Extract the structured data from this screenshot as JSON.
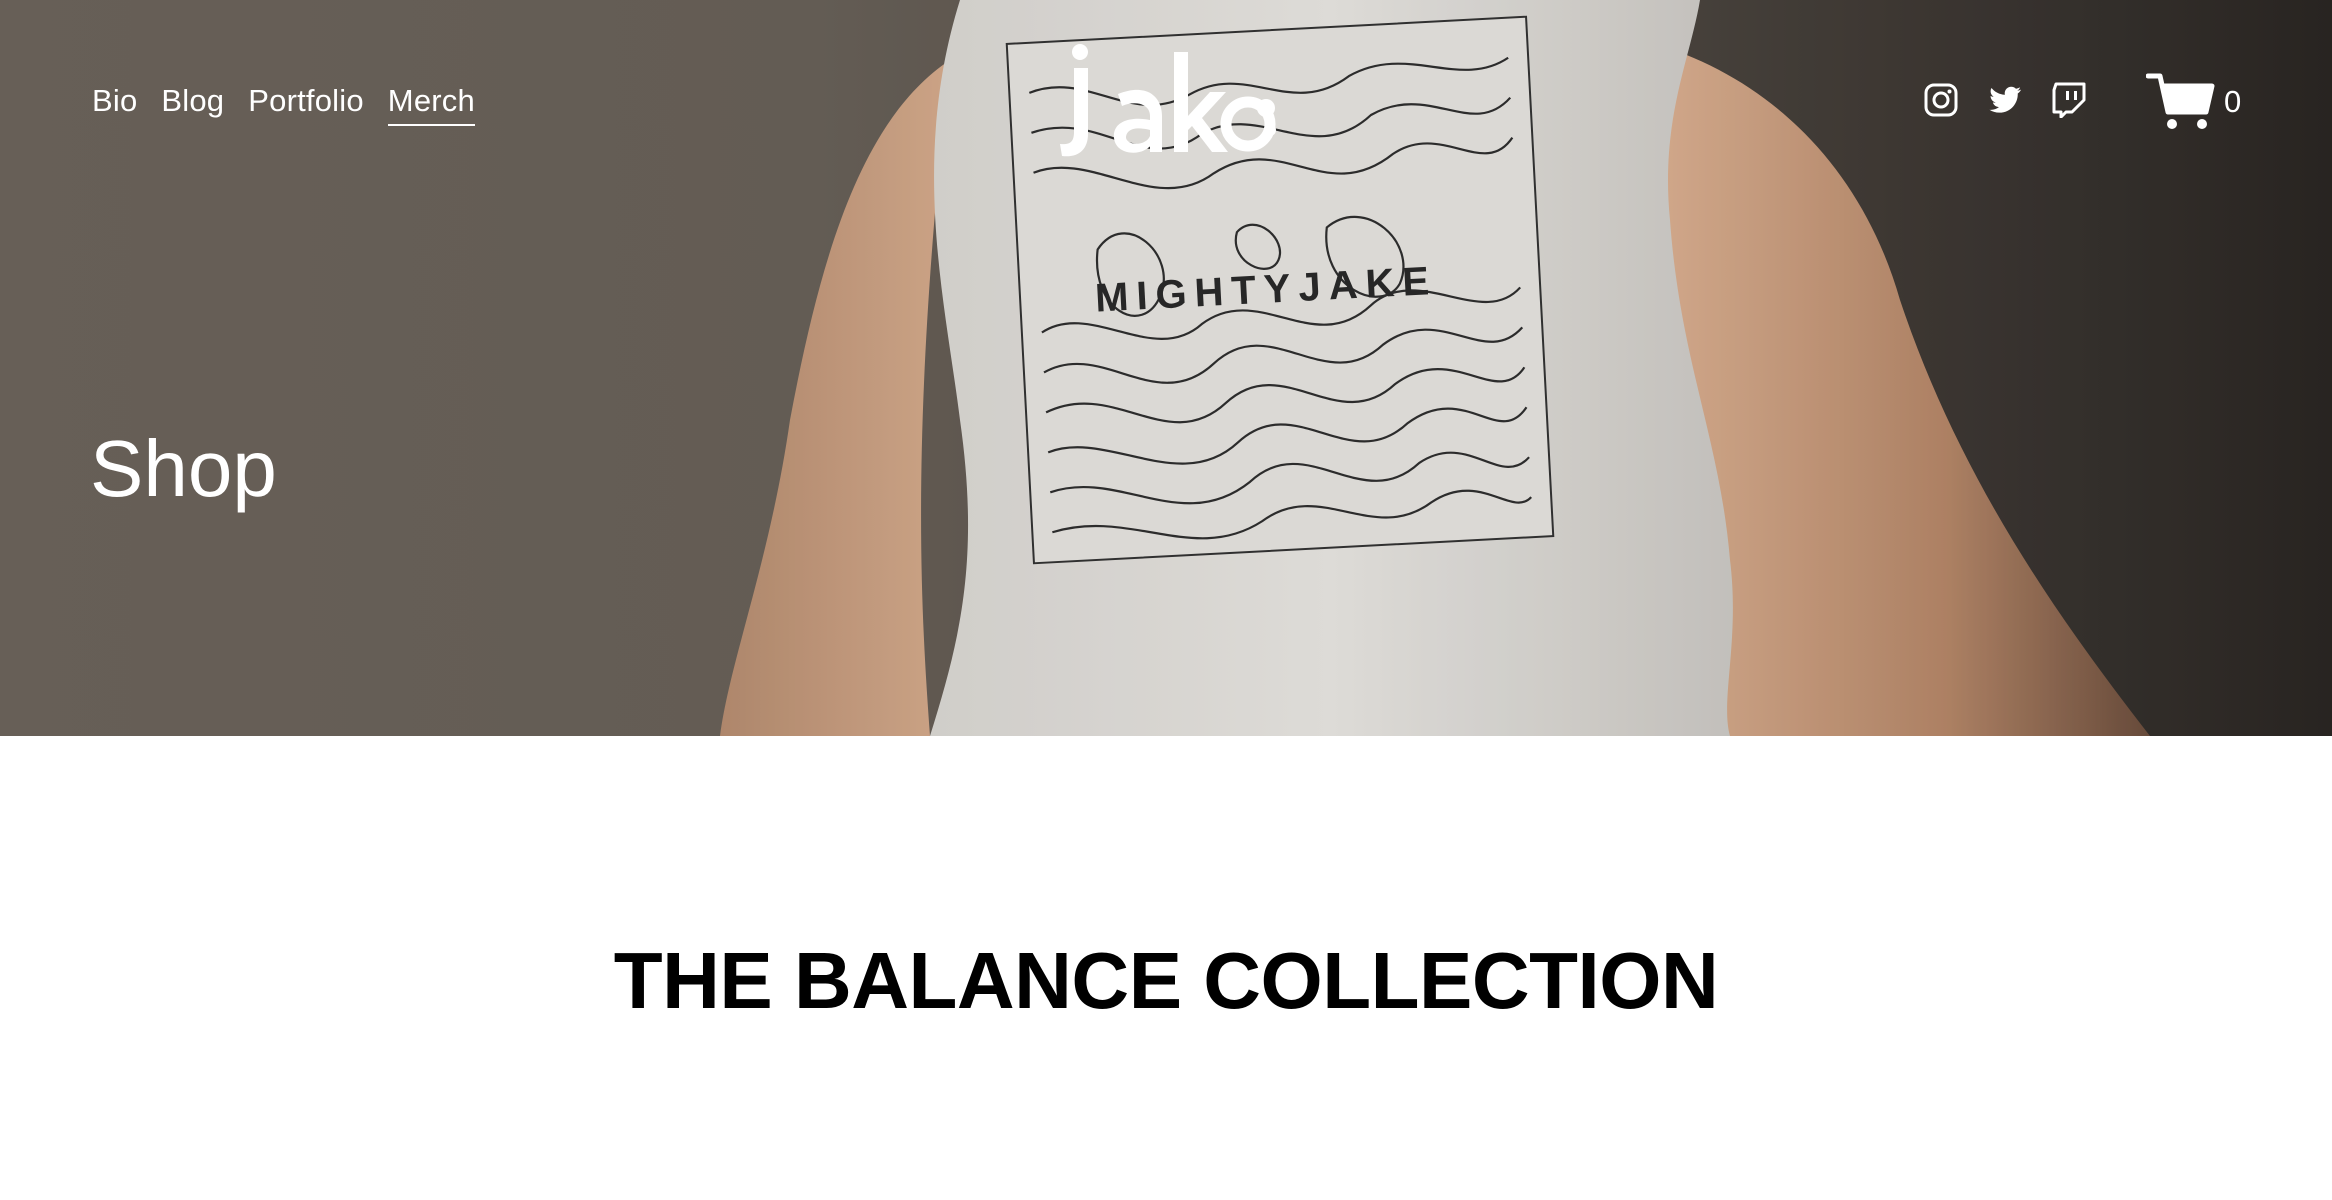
{
  "hero": {
    "shirt_print_text": "MIGHTYJAKE",
    "page_title": "Shop"
  },
  "logo": {
    "text": "Jake"
  },
  "nav": {
    "items": [
      {
        "label": "Bio",
        "active": false
      },
      {
        "label": "Blog",
        "active": false
      },
      {
        "label": "Portfolio",
        "active": false
      },
      {
        "label": "Merch",
        "active": true
      }
    ]
  },
  "social": {
    "icons": [
      "instagram-icon",
      "twitter-icon",
      "twitch-icon"
    ]
  },
  "cart": {
    "icon": "cart-icon",
    "count": "0"
  },
  "main": {
    "section_heading": "THE BALANCE COLLECTION"
  },
  "colors": {
    "text_on_hero": "#ffffff",
    "heading": "#000000",
    "background": "#ffffff"
  }
}
